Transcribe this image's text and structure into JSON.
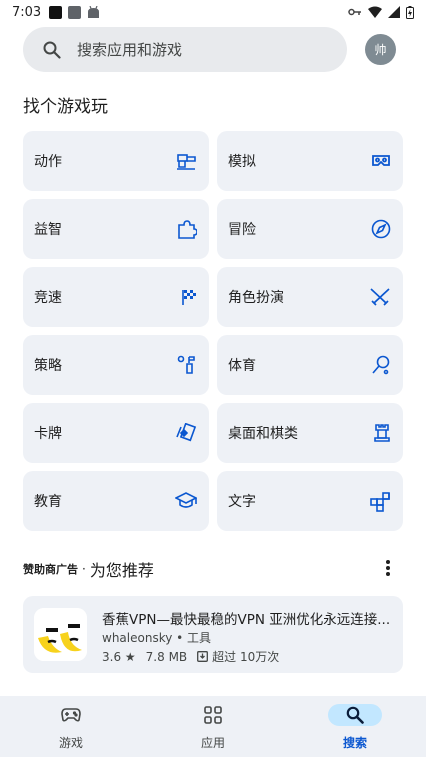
{
  "status_bar": {
    "time": "7:03"
  },
  "search": {
    "placeholder": "搜索应用和游戏"
  },
  "profile": {
    "avatar_text": "帅"
  },
  "section_title": "找个游戏玩",
  "categories": [
    {
      "label": "动作",
      "icon": "action-icon"
    },
    {
      "label": "模拟",
      "icon": "vr-headset-icon"
    },
    {
      "label": "益智",
      "icon": "puzzle-icon"
    },
    {
      "label": "冒险",
      "icon": "compass-icon"
    },
    {
      "label": "竞速",
      "icon": "checkered-flag-icon"
    },
    {
      "label": "角色扮演",
      "icon": "crossed-swords-icon"
    },
    {
      "label": "策略",
      "icon": "strategy-icon"
    },
    {
      "label": "体育",
      "icon": "racket-icon"
    },
    {
      "label": "卡牌",
      "icon": "cards-icon"
    },
    {
      "label": "桌面和棋类",
      "icon": "chess-rook-icon"
    },
    {
      "label": "教育",
      "icon": "graduation-cap-icon"
    },
    {
      "label": "文字",
      "icon": "word-tiles-icon"
    }
  ],
  "ad_section": {
    "sponsor_label": "赞助商广告",
    "separator": "·",
    "title": "为您推荐"
  },
  "app": {
    "title": "香蕉VPN—最快最稳的VPN  亚洲优化永远连接...",
    "developer": "whaleonsky",
    "category": "工具",
    "rating": "3.6",
    "size": "7.8 MB",
    "downloads": "超过 10万次"
  },
  "bottom_nav": {
    "items": [
      {
        "label": "游戏",
        "icon": "gamepad-icon",
        "active": false
      },
      {
        "label": "应用",
        "icon": "apps-grid-icon",
        "active": false
      },
      {
        "label": "搜索",
        "icon": "search-icon",
        "active": true
      }
    ]
  },
  "colors": {
    "accent": "#0b57d0",
    "tile_bg": "#eef1f6",
    "search_bg": "#e8eaed",
    "active_pill": "#c2e7ff"
  }
}
